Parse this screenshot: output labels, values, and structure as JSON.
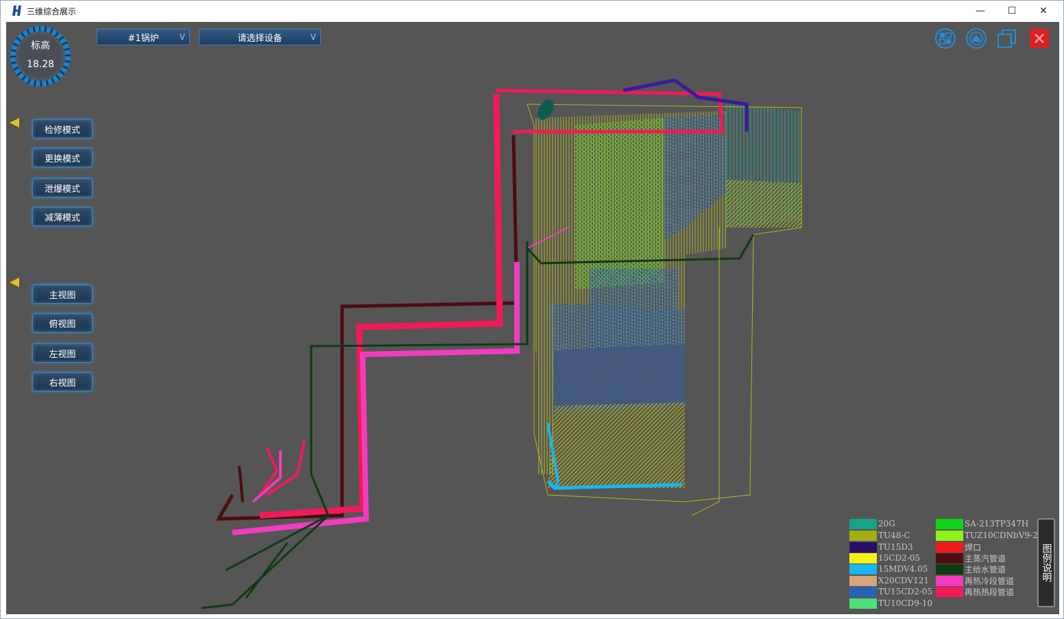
{
  "window": {
    "title": "三维综合展示",
    "controls": {
      "minimize": "—",
      "maximize": "☐",
      "close": "✕"
    }
  },
  "gauge": {
    "label": "标高",
    "value": "18.28"
  },
  "selectors": {
    "boiler": "#1锅炉",
    "device": "请选择设备",
    "chevron": "V"
  },
  "modes": {
    "items": [
      "检修模式",
      "更换模式",
      "泄爆模式",
      "减薄模式"
    ]
  },
  "views": {
    "items": [
      "主视图",
      "俯视图",
      "左视图",
      "右视图"
    ]
  },
  "toolbar": {
    "icons": [
      "grid-view-icon",
      "home-icon",
      "window-copy-icon",
      "close-icon"
    ],
    "accent": "#1e8fe0",
    "close_color": "#e02828"
  },
  "legend": {
    "tab_label": "图例说明",
    "items": [
      {
        "label": "20G",
        "color": "#15a38a"
      },
      {
        "label": "TU48-C",
        "color": "#a5ad13"
      },
      {
        "label": "TU15D3",
        "color": "#2a0f6e"
      },
      {
        "label": "15CD2-05",
        "color": "#f2f216"
      },
      {
        "label": "15MDV4.05",
        "color": "#18b7f0"
      },
      {
        "label": "X20CDV121",
        "color": "#d7a47c"
      },
      {
        "label": "TU15CD2-05",
        "color": "#2c62b4"
      },
      {
        "label": "TU10CD9-10",
        "color": "#4fe07a"
      },
      {
        "label": "SA-213TP347H",
        "color": "#11d419"
      },
      {
        "label": "TUZ10CDNbV9-2",
        "color": "#8ff21c"
      },
      {
        "label": "焊口",
        "color": "#f01a1a"
      },
      {
        "label": "主蒸汽管道",
        "color": "#4a0d12"
      },
      {
        "label": "主给水管道",
        "color": "#0f3a14"
      },
      {
        "label": "再热冷段管道",
        "color": "#f23cc0"
      },
      {
        "label": "再热热段管道",
        "color": "#f21a58"
      }
    ]
  }
}
